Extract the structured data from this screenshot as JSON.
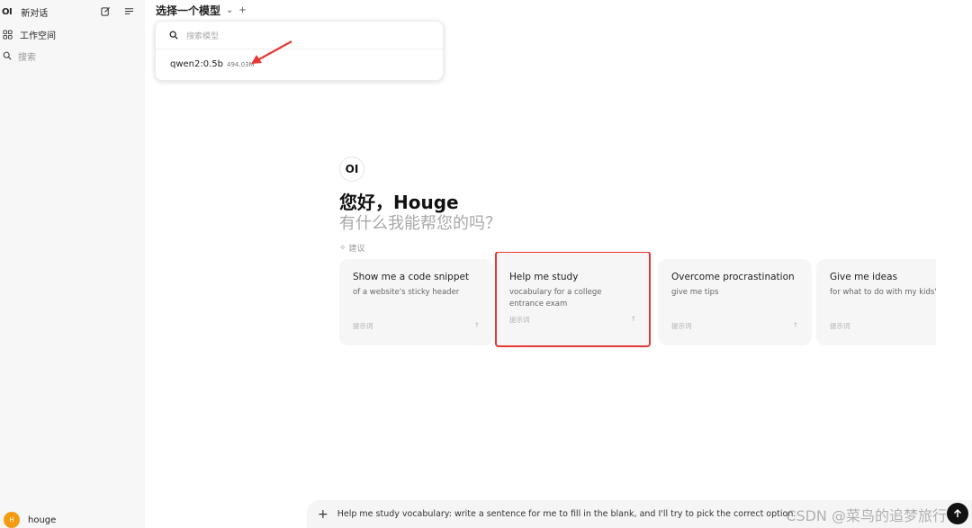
{
  "sidebar": {
    "logo": "OI",
    "new_chat": "新对话",
    "workspace": "工作空间",
    "search_placeholder": "搜索",
    "user": {
      "initial": "H",
      "name": "houge"
    }
  },
  "header": {
    "model_select_label": "选择一个模型",
    "chevron": "⌄",
    "add": "+"
  },
  "model_dropdown": {
    "search_placeholder": "搜索模型",
    "items": [
      {
        "name": "qwen2:0.5b",
        "size": "494.03M"
      }
    ]
  },
  "greeting": {
    "logo": "OI",
    "hello": "您好，Houge",
    "subtitle": "有什么我能帮您的吗？",
    "suggestions_label": "建议"
  },
  "cards": [
    {
      "title": "Show me a code snippet",
      "desc": "of a website's sticky header",
      "foot": "提示词",
      "highlighted": false
    },
    {
      "title": "Help me study",
      "desc": "vocabulary for a college entrance exam",
      "foot": "提示词",
      "highlighted": true
    },
    {
      "title": "Overcome procrastination",
      "desc": "give me tips",
      "foot": "提示词",
      "highlighted": false
    },
    {
      "title": "Give me ideas",
      "desc": "for what to do with my kids' art",
      "foot": "提示词",
      "highlighted": false
    }
  ],
  "composer": {
    "text": "Help me study vocabulary: write a sentence for me to fill in the blank, and I'll try to pick the correct option.",
    "watermark": "CSDN @菜鸟的追梦旅行"
  },
  "colors": {
    "highlight": "#e53935",
    "avatar": "#f39c12"
  }
}
